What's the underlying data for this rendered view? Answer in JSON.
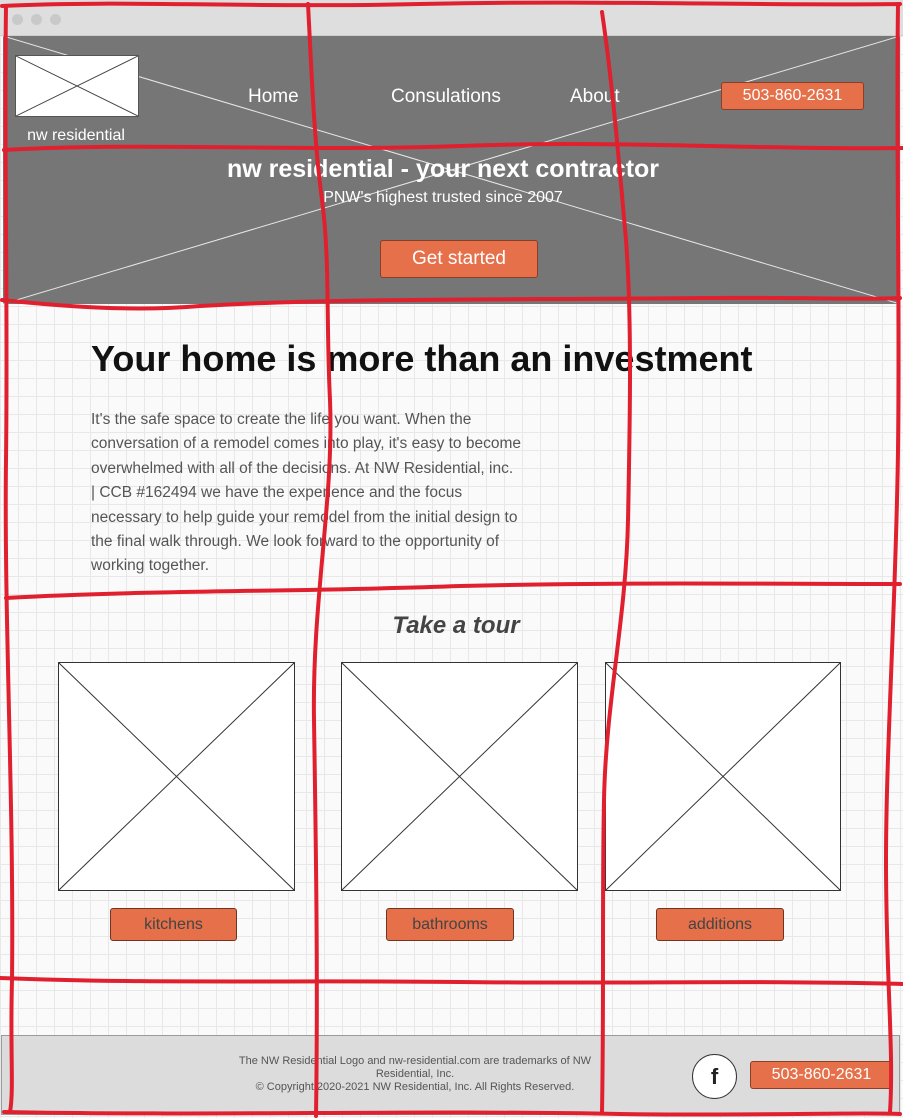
{
  "header": {
    "logo_text": "nw residential",
    "nav": [
      "Home",
      "Consulations",
      "About"
    ],
    "phone": "503-860-2631"
  },
  "hero": {
    "title": "nw residential - your next contractor",
    "subtitle": "PNW's highest trusted since 2007",
    "cta": "Get started"
  },
  "content": {
    "headline": "Your home is more than an investment",
    "body": "It's the safe space to create the life you want. When the conversation of a remodel comes into play, it's easy to become overwhelmed with all of the decisions. At NW Residential, inc. | CCB #162494 we have the experience and the focus necessary to help guide your remodel from the initial design to the final walk through. We look forward to the opportunity of working together."
  },
  "tour": {
    "title": "Take a tour",
    "buttons": [
      "kitchens",
      "bathrooms",
      "additions"
    ]
  },
  "footer": {
    "line1": "The NW Residential Logo and nw-residential.com are trademarks of NW Residential, Inc.",
    "line2": "© Copyright 2020-2021 NW Residential, Inc. All Rights Reserved.",
    "social_icon": "facebook-icon",
    "social_glyph": "f",
    "phone": "503-860-2631"
  },
  "colors": {
    "accent": "#e5704a",
    "header_bg": "#767676",
    "annotation": "#e0202e"
  }
}
